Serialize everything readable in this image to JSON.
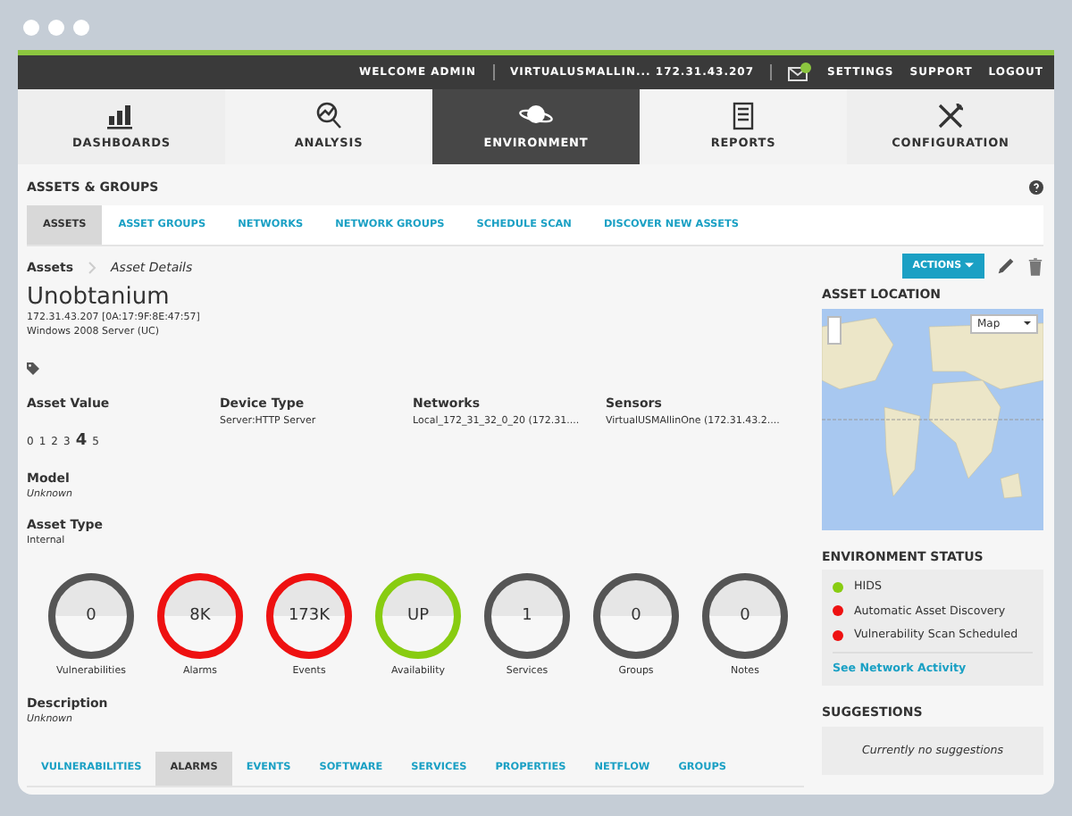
{
  "topbar": {
    "welcome": "WELCOME ADMIN",
    "server": "VIRTUALUSMALLIN... 172.31.43.207",
    "links": [
      {
        "label": "SETTINGS"
      },
      {
        "label": "SUPPORT"
      },
      {
        "label": "LOGOUT"
      }
    ]
  },
  "main_nav": [
    {
      "label": "DASHBOARDS",
      "selected": false
    },
    {
      "label": "ANALYSIS",
      "selected": false
    },
    {
      "label": "ENVIRONMENT",
      "selected": true
    },
    {
      "label": "REPORTS",
      "selected": false
    },
    {
      "label": "CONFIGURATION",
      "selected": false
    }
  ],
  "section_title": "ASSETS & GROUPS",
  "sub_tabs": [
    {
      "label": "ASSETS",
      "selected": true
    },
    {
      "label": "ASSET GROUPS",
      "selected": false
    },
    {
      "label": "NETWORKS",
      "selected": false
    },
    {
      "label": "NETWORK GROUPS",
      "selected": false
    },
    {
      "label": "SCHEDULE SCAN",
      "selected": false
    },
    {
      "label": "DISCOVER NEW ASSETS",
      "selected": false
    }
  ],
  "breadcrumb": {
    "link": "Assets",
    "current": "Asset Details"
  },
  "actions_button": "ACTIONS",
  "asset": {
    "name": "Unobtanium",
    "address": "172.31.43.207 [0A:17:9F:8E:47:57]",
    "os": "Windows 2008 Server (UC)",
    "asset_value": {
      "label": "Asset Value",
      "options": [
        {
          "value": "0",
          "selected": false
        },
        {
          "value": "1",
          "selected": false
        },
        {
          "value": "2",
          "selected": false
        },
        {
          "value": "3",
          "selected": false
        },
        {
          "value": "4",
          "selected": true
        },
        {
          "value": "5",
          "selected": false
        }
      ]
    },
    "fields": [
      {
        "label": "Device Type",
        "value": "Server:HTTP Server"
      },
      {
        "label": "Networks",
        "value": "Local_172_31_32_0_20 (172.31...."
      },
      {
        "label": "Sensors",
        "value": "VirtualUSMAllinOne (172.31.43.2...."
      }
    ],
    "model": {
      "label": "Model",
      "value": "Unknown"
    },
    "asset_type": {
      "label": "Asset Type",
      "value": "Internal"
    },
    "description": {
      "label": "Description",
      "value": "Unknown"
    }
  },
  "stats": [
    {
      "value": "0",
      "label": "Vulnerabilities",
      "color": "#555555"
    },
    {
      "value": "8K",
      "label": "Alarms",
      "color": "#ee1111"
    },
    {
      "value": "173K",
      "label": "Events",
      "color": "#ee1111"
    },
    {
      "value": "UP",
      "label": "Availability",
      "color": "#88cc11"
    },
    {
      "value": "1",
      "label": "Services",
      "color": "#555555"
    },
    {
      "value": "0",
      "label": "Groups",
      "color": "#555555"
    },
    {
      "value": "0",
      "label": "Notes",
      "color": "#555555"
    }
  ],
  "bottom_tabs": [
    {
      "label": "VULNERABILITIES",
      "selected": false
    },
    {
      "label": "ALARMS",
      "selected": true
    },
    {
      "label": "EVENTS",
      "selected": false
    },
    {
      "label": "SOFTWARE",
      "selected": false
    },
    {
      "label": "SERVICES",
      "selected": false
    },
    {
      "label": "PROPERTIES",
      "selected": false
    },
    {
      "label": "NETFLOW",
      "selected": false
    },
    {
      "label": "GROUPS",
      "selected": false
    }
  ],
  "asset_location": {
    "title": "ASSET LOCATION",
    "map_type": "Map"
  },
  "environment_status": {
    "title": "ENVIRONMENT STATUS",
    "items": [
      {
        "label": "HIDS",
        "color": "#88cc11"
      },
      {
        "label": "Automatic Asset Discovery",
        "color": "#ee1111"
      },
      {
        "label": "Vulnerability Scan Scheduled",
        "color": "#ee1111"
      }
    ],
    "link": "See Network Activity"
  },
  "suggestions": {
    "title": "SUGGESTIONS",
    "message": "Currently no suggestions"
  }
}
